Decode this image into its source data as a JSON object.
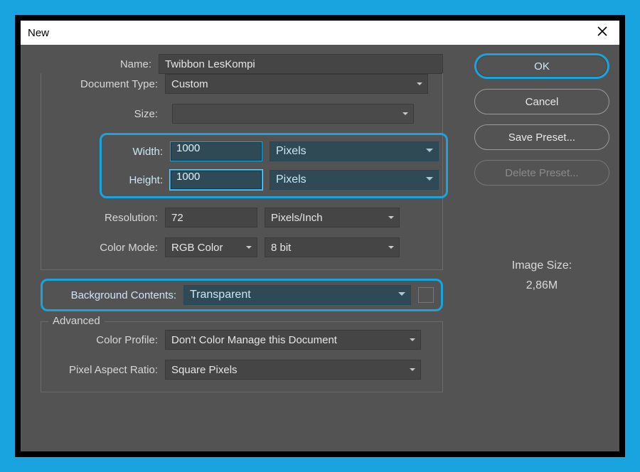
{
  "window": {
    "title": "New"
  },
  "form": {
    "name_label": "Name:",
    "name_value": "Twibbon LesKompi",
    "doc_type_label": "Document Type:",
    "doc_type_value": "Custom",
    "size_label": "Size:",
    "size_value": "",
    "width_label": "Width:",
    "width_value": "1000",
    "width_unit": "Pixels",
    "height_label": "Height:",
    "height_value": "1000",
    "height_unit": "Pixels",
    "resolution_label": "Resolution:",
    "resolution_value": "72",
    "resolution_unit": "Pixels/Inch",
    "color_mode_label": "Color Mode:",
    "color_mode_value": "RGB Color",
    "color_depth_value": "8 bit",
    "bg_label": "Background Contents:",
    "bg_value": "Transparent"
  },
  "advanced": {
    "legend": "Advanced",
    "profile_label": "Color Profile:",
    "profile_value": "Don't Color Manage this Document",
    "par_label": "Pixel Aspect Ratio:",
    "par_value": "Square Pixels"
  },
  "side": {
    "ok": "OK",
    "cancel": "Cancel",
    "save_preset": "Save Preset...",
    "delete_preset": "Delete Preset...",
    "image_size_label": "Image Size:",
    "image_size_value": "2,86M"
  },
  "colors": {
    "highlight": "#1aa4df"
  }
}
